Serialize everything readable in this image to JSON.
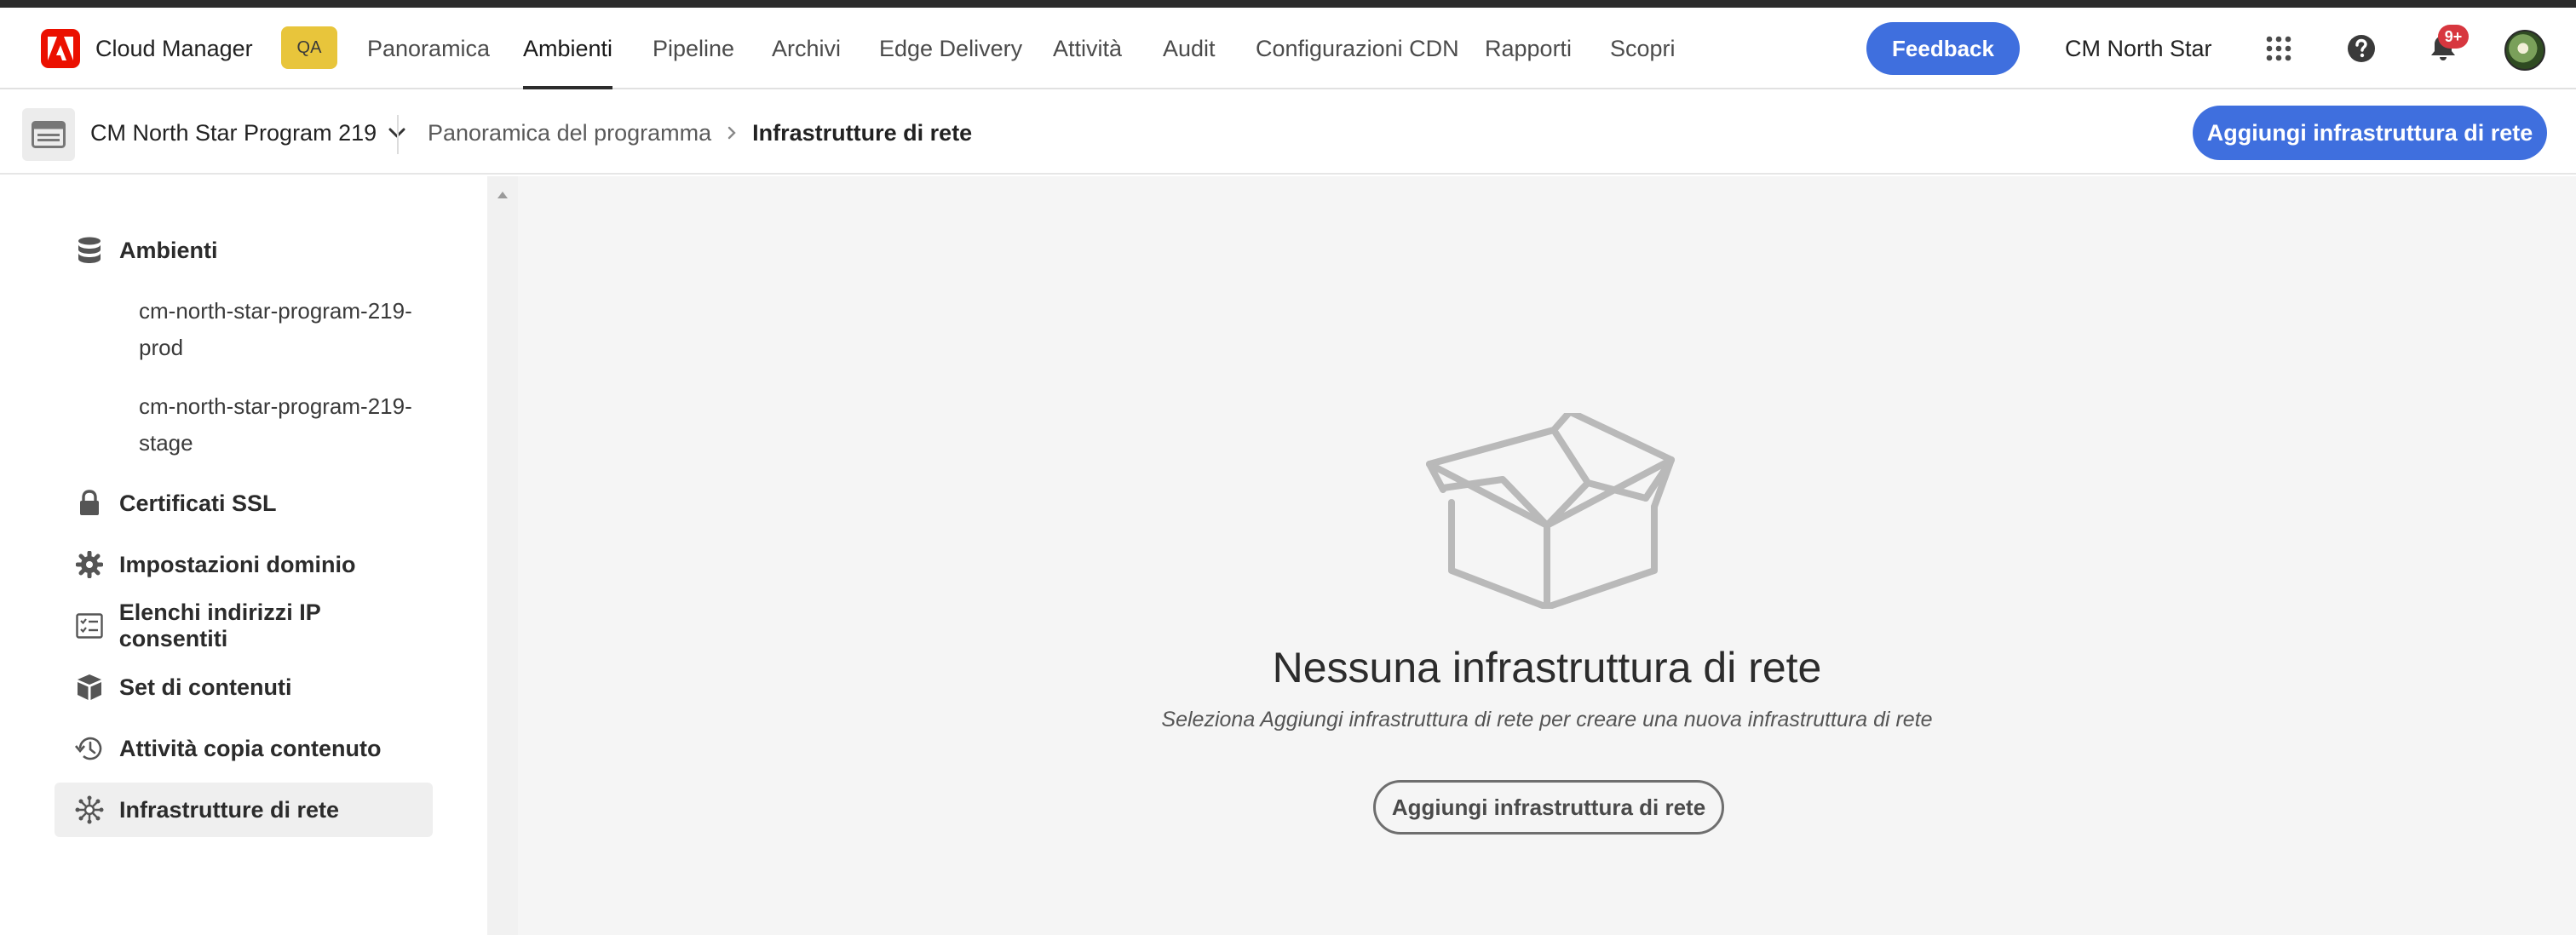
{
  "app": {
    "name": "Cloud Manager",
    "env_badge": "QA",
    "colors": {
      "accent": "#3f6fde",
      "brand": "#eb1000",
      "badge": "#e8c53b",
      "notification": "#d7373f"
    }
  },
  "nav": {
    "items": [
      {
        "label": "Panoramica",
        "active": false
      },
      {
        "label": "Ambienti",
        "active": true
      },
      {
        "label": "Pipeline",
        "active": false
      },
      {
        "label": "Archivi",
        "active": false
      },
      {
        "label": "Edge Delivery",
        "active": false
      },
      {
        "label": "Attività",
        "active": false
      },
      {
        "label": "Audit",
        "active": false
      },
      {
        "label": "Configurazioni CDN",
        "active": false
      },
      {
        "label": "Rapporti",
        "active": false
      },
      {
        "label": "Scopri",
        "active": false
      }
    ],
    "feedback_label": "Feedback",
    "org_name": "CM North Star",
    "notifications_count": "9+",
    "icons": [
      "apps-grid-icon",
      "help-icon",
      "bell-icon",
      "avatar"
    ]
  },
  "subheader": {
    "program_name": "CM North Star Program 219",
    "breadcrumb": [
      "Panoramica del programma",
      "Infrastrutture di rete"
    ],
    "add_button_label": "Aggiungi infrastruttura di rete"
  },
  "sidebar": {
    "items": [
      {
        "label": "Ambienti",
        "icon": "database-icon",
        "selected": false
      },
      {
        "label": "Certificati SSL",
        "icon": "lock-icon",
        "selected": false
      },
      {
        "label": "Impostazioni dominio",
        "icon": "gear-icon",
        "selected": false
      },
      {
        "label": "Elenchi indirizzi IP consentiti",
        "icon": "checklist-icon",
        "selected": false
      },
      {
        "label": "Set di contenuti",
        "icon": "boxes-icon",
        "selected": false
      },
      {
        "label": "Attività copia contenuto",
        "icon": "history-icon",
        "selected": false
      },
      {
        "label": "Infrastrutture di rete",
        "icon": "network-icon",
        "selected": true
      }
    ],
    "environments": [
      {
        "line1": "cm-north-star-program-219-",
        "line2": "prod"
      },
      {
        "line1": "cm-north-star-program-219-",
        "line2": "stage"
      }
    ]
  },
  "empty_state": {
    "icon": "empty-box-icon",
    "title": "Nessuna infrastruttura di rete",
    "description": "Seleziona Aggiungi infrastruttura di rete per creare una nuova infrastruttura di rete",
    "button_label": "Aggiungi infrastruttura di rete"
  }
}
